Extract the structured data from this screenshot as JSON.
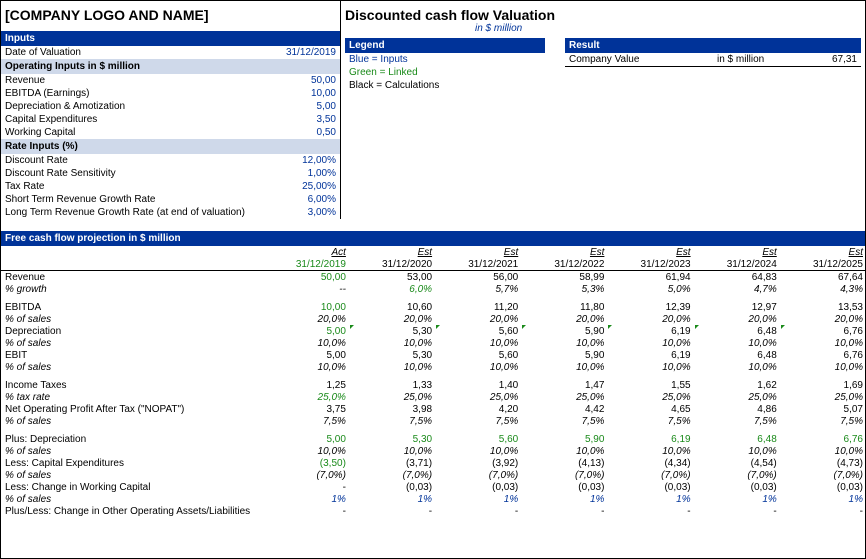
{
  "company_placeholder": "[COMPANY LOGO AND NAME]",
  "title": "Discounted cash flow Valuation",
  "subtitle": "in $ million",
  "inputs_header": "Inputs",
  "date_label": "Date of Valuation",
  "date_value": "31/12/2019",
  "op_header": "Operating Inputs in $ million",
  "op": {
    "revenue_l": "Revenue",
    "revenue_v": "50,00",
    "ebitda_l": "EBITDA (Earnings)",
    "ebitda_v": "10,00",
    "da_l": "Depreciation & Amotization",
    "da_v": "5,00",
    "capex_l": "Capital Expenditures",
    "capex_v": "3,50",
    "wc_l": "Working Capital",
    "wc_v": "0,50"
  },
  "rate_header": "Rate Inputs (%)",
  "rate": {
    "discount_l": "Discount Rate",
    "discount_v": "12,00%",
    "sens_l": "Discount Rate Sensitivity",
    "sens_v": "1,00%",
    "tax_l": "Tax Rate",
    "tax_v": "25,00%",
    "st_l": "Short Term Revenue Growth Rate",
    "st_v": "6,00%",
    "lt_l": "Long Term Revenue Growth Rate (at end of valuation)",
    "lt_v": "3,00%"
  },
  "legend_header": "Legend",
  "legend": {
    "blue": "Blue = Inputs",
    "green": "Green = Linked",
    "black": "Black = Calculations"
  },
  "result_header": "Result",
  "result": {
    "label": "Company Value",
    "unit": "in $ million",
    "value": "67,31"
  },
  "proj_header": "Free cash flow projection in $ million",
  "col_type": {
    "c0": "Act",
    "c1": "Est",
    "c2": "Est",
    "c3": "Est",
    "c4": "Est",
    "c5": "Est",
    "c6": "Est"
  },
  "col_date": {
    "c0": "31/12/2019",
    "c1": "31/12/2020",
    "c2": "31/12/2021",
    "c3": "31/12/2022",
    "c4": "31/12/2023",
    "c5": "31/12/2024",
    "c6": "31/12/2025"
  },
  "rows": {
    "revenue": {
      "l": "Revenue",
      "c0": "50,00",
      "c1": "53,00",
      "c2": "56,00",
      "c3": "58,99",
      "c4": "61,94",
      "c5": "64,83",
      "c6": "67,64"
    },
    "growth": {
      "l": "% growth",
      "c0": "--",
      "c1": "6,0%",
      "c2": "5,7%",
      "c3": "5,3%",
      "c4": "5,0%",
      "c5": "4,7%",
      "c6": "4,3%"
    },
    "ebitda": {
      "l": "EBITDA",
      "c0": "10,00",
      "c1": "10,60",
      "c2": "11,20",
      "c3": "11,80",
      "c4": "12,39",
      "c5": "12,97",
      "c6": "13,53"
    },
    "ebitda_p": {
      "l": "% of sales",
      "c0": "20,0%",
      "c1": "20,0%",
      "c2": "20,0%",
      "c3": "20,0%",
      "c4": "20,0%",
      "c5": "20,0%",
      "c6": "20,0%"
    },
    "dep": {
      "l": "Depreciation",
      "c0": "5,00",
      "c1": "5,30",
      "c2": "5,60",
      "c3": "5,90",
      "c4": "6,19",
      "c5": "6,48",
      "c6": "6,76"
    },
    "dep_p": {
      "l": "% of sales",
      "c0": "10,0%",
      "c1": "10,0%",
      "c2": "10,0%",
      "c3": "10,0%",
      "c4": "10,0%",
      "c5": "10,0%",
      "c6": "10,0%"
    },
    "ebit": {
      "l": "EBIT",
      "c0": "5,00",
      "c1": "5,30",
      "c2": "5,60",
      "c3": "5,90",
      "c4": "6,19",
      "c5": "6,48",
      "c6": "6,76"
    },
    "ebit_p": {
      "l": "% of sales",
      "c0": "10,0%",
      "c1": "10,0%",
      "c2": "10,0%",
      "c3": "10,0%",
      "c4": "10,0%",
      "c5": "10,0%",
      "c6": "10,0%"
    },
    "tax": {
      "l": "Income Taxes",
      "c0": "1,25",
      "c1": "1,33",
      "c2": "1,40",
      "c3": "1,47",
      "c4": "1,55",
      "c5": "1,62",
      "c6": "1,69"
    },
    "taxr": {
      "l": "% tax rate",
      "c0": "25,0%",
      "c1": "25,0%",
      "c2": "25,0%",
      "c3": "25,0%",
      "c4": "25,0%",
      "c5": "25,0%",
      "c6": "25,0%"
    },
    "nopat": {
      "l": "Net Operating Profit After Tax (\"NOPAT\")",
      "c0": "3,75",
      "c1": "3,98",
      "c2": "4,20",
      "c3": "4,42",
      "c4": "4,65",
      "c5": "4,86",
      "c6": "5,07"
    },
    "nopat_p": {
      "l": "% of sales",
      "c0": "7,5%",
      "c1": "7,5%",
      "c2": "7,5%",
      "c3": "7,5%",
      "c4": "7,5%",
      "c5": "7,5%",
      "c6": "7,5%"
    },
    "pdep": {
      "l": "Plus: Depreciation",
      "c0": "5,00",
      "c1": "5,30",
      "c2": "5,60",
      "c3": "5,90",
      "c4": "6,19",
      "c5": "6,48",
      "c6": "6,76"
    },
    "pdep_p": {
      "l": "% of sales",
      "c0": "10,0%",
      "c1": "10,0%",
      "c2": "10,0%",
      "c3": "10,0%",
      "c4": "10,0%",
      "c5": "10,0%",
      "c6": "10,0%"
    },
    "lcapex": {
      "l": "Less: Capital Expenditures",
      "c0": "(3,50)",
      "c1": "(3,71)",
      "c2": "(3,92)",
      "c3": "(4,13)",
      "c4": "(4,34)",
      "c5": "(4,54)",
      "c6": "(4,73)"
    },
    "lcapex_p": {
      "l": "% of sales",
      "c0": "(7,0%)",
      "c1": "(7,0%)",
      "c2": "(7,0%)",
      "c3": "(7,0%)",
      "c4": "(7,0%)",
      "c5": "(7,0%)",
      "c6": "(7,0%)"
    },
    "lwc": {
      "l": "Less: Change in Working Capital",
      "c0": "-",
      "c1": "(0,03)",
      "c2": "(0,03)",
      "c3": "(0,03)",
      "c4": "(0,03)",
      "c5": "(0,03)",
      "c6": "(0,03)"
    },
    "lwc_p": {
      "l": "% of sales",
      "c0": "1%",
      "c1": "1%",
      "c2": "1%",
      "c3": "1%",
      "c4": "1%",
      "c5": "1%",
      "c6": "1%"
    },
    "pl": {
      "l": "Plus/Less: Change in Other Operating Assets/Liabilities",
      "c0": "-",
      "c1": "-",
      "c2": "-",
      "c3": "-",
      "c4": "-",
      "c5": "-",
      "c6": "-"
    }
  }
}
